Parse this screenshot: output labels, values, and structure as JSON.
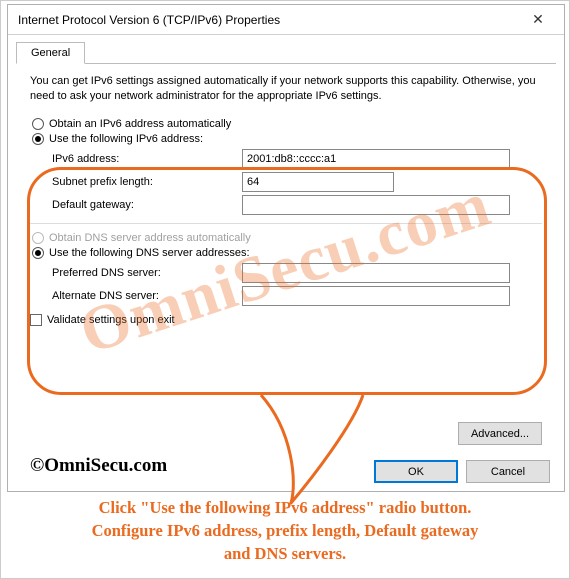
{
  "window": {
    "title": "Internet Protocol Version 6 (TCP/IPv6) Properties",
    "tab": "General",
    "close_glyph": "✕"
  },
  "desc": "You can get IPv6 settings assigned automatically if your network supports this capability. Otherwise, you need to ask your network administrator for the appropriate IPv6 settings.",
  "ipv6": {
    "auto_label": "Obtain an IPv6 address automatically",
    "manual_label": "Use the following IPv6 address:",
    "addr_label": "IPv6 address:",
    "addr_value": "2001:db8::cccc:a1",
    "prefix_label": "Subnet prefix length:",
    "prefix_value": "64",
    "gw_label": "Default gateway:",
    "gw_value": ""
  },
  "dns": {
    "auto_label": "Obtain DNS server address automatically",
    "manual_label": "Use the following DNS server addresses:",
    "pref_label": "Preferred DNS server:",
    "pref_value": "",
    "alt_label": "Alternate DNS server:",
    "alt_value": ""
  },
  "validate_label": "Validate settings upon exit",
  "buttons": {
    "advanced": "Advanced...",
    "ok": "OK",
    "cancel": "Cancel"
  },
  "watermark": "OmniSecu.com",
  "copyright": "©OmniSecu.com",
  "caption_lines": [
    "Click \"Use the following IPv6 address\" radio button.",
    "Configure IPv6 address, prefix length, Default gateway",
    "and DNS servers."
  ],
  "colors": {
    "accent": "#ea6a20",
    "primary": "#0078d7"
  }
}
